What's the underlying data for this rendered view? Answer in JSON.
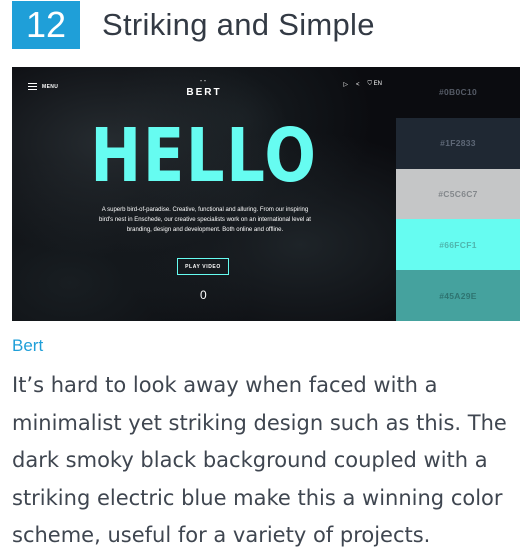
{
  "header": {
    "number": "12",
    "title": "Striking and Simple"
  },
  "preview": {
    "menu_label": "MENU",
    "logo_mark": "\"\"",
    "logo_text": "BERT",
    "top_icons": [
      "▷",
      "<",
      "⛉ EN"
    ],
    "hero_text": "HELLO",
    "description": "A superb bird-of-paradise. Creative, functional and alluring. From our inspiring bird's nest in Enschede, our creative specialists work on an international level at branding, design and development. Both online and offline.",
    "play_label": "PLAY VIDEO",
    "scroll_indicator": "0"
  },
  "palette": [
    {
      "hex": "#0B0C10",
      "color": "#0b0c10",
      "text_color": "#555b66"
    },
    {
      "hex": "#1F2833",
      "color": "#1f2833",
      "text_color": "#5e6877"
    },
    {
      "hex": "#C5C6C7",
      "color": "#c5c6c7",
      "text_color": "#83878b"
    },
    {
      "hex": "#66FCF1",
      "color": "#66fcf1",
      "text_color": "#4fb6ae"
    },
    {
      "hex": "#45A29E",
      "color": "#45a29e",
      "text_color": "#2e7471"
    }
  ],
  "link_text": "Bert",
  "body_text": "It’s hard to look away when faced with a minimalist yet striking design such as this. The dark smoky black background coupled with a striking electric blue make this a winning color scheme, useful for a variety of projects."
}
